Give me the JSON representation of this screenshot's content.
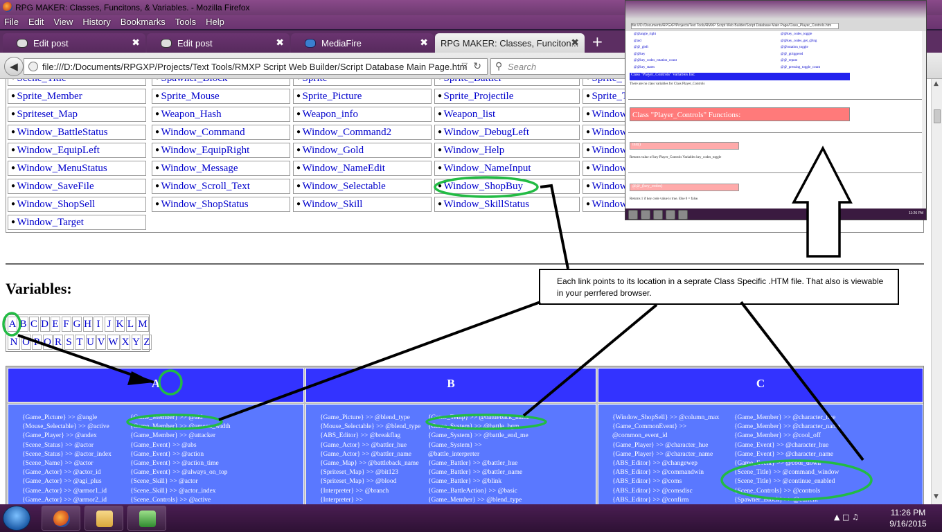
{
  "window": {
    "title": "RPG MAKER: Classes, Funcitons, & Variables. - Mozilla Firefox"
  },
  "menu": [
    "File",
    "Edit",
    "View",
    "History",
    "Bookmarks",
    "Tools",
    "Help"
  ],
  "tabs": [
    {
      "label": "Edit post",
      "close": "✖"
    },
    {
      "label": "Edit post",
      "close": "✖"
    },
    {
      "label": "MediaFire",
      "close": "✖"
    },
    {
      "label": "RPG MAKER: Classes, Funciton...",
      "close": "✖"
    }
  ],
  "new_tab": "+",
  "url": "file:///D:/Documents/RPGXP/Projects/Text Tools/RMXP Script Web Builder/Script Database Main Page.htm",
  "search_placeholder": "Search",
  "class_rows": [
    [
      "Scene_Title",
      "Spawner_Block",
      "Sprite",
      "Sprite_Battler",
      "Sprite_"
    ],
    [
      "Sprite_Member",
      "Sprite_Mouse",
      "Sprite_Picture",
      "Sprite_Projectile",
      "Sprite_T"
    ],
    [
      "Spriteset_Map",
      "Weapon_Hash",
      "Weapon_info",
      "Weapon_list",
      "Window"
    ],
    [
      "Window_BattleStatus",
      "Window_Command",
      "Window_Command2",
      "Window_DebugLeft",
      "Window"
    ],
    [
      "Window_EquipLeft",
      "Window_EquipRight",
      "Window_Gold",
      "Window_Help",
      "Window"
    ],
    [
      "Window_MenuStatus",
      "Window_Message",
      "Window_NameEdit",
      "Window_NameInput",
      "Window"
    ],
    [
      "Window_SaveFile",
      "Window_Scroll_Text",
      "Window_Selectable",
      "Window_ShopBuy",
      "Window"
    ],
    [
      "Window_ShopSell",
      "Window_ShopStatus",
      "Window_Skill",
      "Window_SkillStatus",
      "Window"
    ],
    [
      "Window_Target"
    ]
  ],
  "variables_heading": "Variables:",
  "letters_row1": [
    "A",
    "B",
    "C",
    "D",
    "E",
    "F",
    "G",
    "H",
    "I",
    "J",
    "K",
    "L",
    "M"
  ],
  "letters_row2": [
    "N",
    "O",
    "P",
    "Q",
    "R",
    "S",
    "T",
    "U",
    "V",
    "W",
    "X",
    "Y",
    "Z"
  ],
  "var_sections": [
    {
      "head": "A",
      "col1": [
        "{Game_Picture} >> @angle",
        "{Mouse_Selectable} >> @active",
        "{Game_Player} >> @andex",
        "{Scene_Status} >> @actor",
        "{Scene_Status} >> @actor_index",
        "{Scene_Name} >> @actor",
        "{Game_Actor} >> @actor_id",
        "{Game_Actor} >> @agi_plus",
        "{Game_Actor} >> @armor1_id",
        "{Game_Actor} >> @armor2_id"
      ],
      "col2": [
        "{Game_Member} >> @aid",
        "{Game_Member} >> @amenu_width",
        "{Game_Member} >> @attacker",
        "{Game_Event} >> @abs",
        "{Game_Event} >> @action",
        "{Game_Event} >> @action_time",
        "{Game_Event} >> @always_on_top",
        "{Scene_Skill} >> @actor",
        "{Scene_Skill} >> @actor_index",
        "{Scene_Controls} >> @active"
      ]
    },
    {
      "head": "B",
      "col1": [
        "{Game_Picture} >> @blend_type",
        "{Mouse_Selectable} >> @blend_type",
        "{ABS_Editor} >> @breakflag",
        "{Game_Actor} >> @battler_hue",
        "{Game_Actor} >> @battler_name",
        "{Game_Map} >> @battleback_name",
        "{Spriteset_Map} >> @bit123",
        "{Spriteset_Map} >> @blood",
        "{Interpreter} >> @branch",
        "{Interpreter} >>"
      ],
      "col2": [
        "{Game_Temp} >> @battleback_name",
        "{Game_System} >> @battle_bgm",
        "{Game_System} >> @battle_end_me",
        "{Game_System} >>",
        "@battle_interpreter",
        "{Game_Battler} >> @battler_hue",
        "{Game_Battler} >> @battler_name",
        "{Game_Battler} >> @blink",
        "{Game_BattleAction} >> @basic",
        "{Game_Member} >> @blend_type"
      ]
    },
    {
      "head": "C",
      "col1": [
        "{Window_ShopSell} >> @column_max",
        "{Game_CommonEvent} >>",
        "@common_event_id",
        "{Game_Player} >> @character_hue",
        "{Game_Player} >> @character_name",
        "{ABS_Editor} >> @changewep",
        "{ABS_Editor} >> @commandwin",
        "{ABS_Editor} >> @coms",
        "{ABS_Editor} >> @comsdisc",
        "{ABS_Editor} >> @confirm"
      ],
      "col2": [
        "{Game_Member} >> @character_hue",
        "{Game_Member} >> @character_name",
        "{Game_Member} >> @cool_off",
        "{Game_Event} >> @character_hue",
        "{Game_Event} >> @character_name",
        "{Game_Event} >> @cool_down",
        "{Scene_Title} >> @command_window",
        "{Scene_Title} >> @continue_enabled",
        "{Scene_Controls} >> @controls",
        "{Spawner_Block} >> @current"
      ]
    }
  ],
  "callout_text": "Each link points to its location in a seprate Class Specific .HTM file. That also is viewable in your perrfered browser.",
  "inset": {
    "url": "file:///D:/Documents/RPGXP/Projects/Text Tools/RMXP Script Web Builder/Script Database Main Page/Class_Player_Controls.htm",
    "links_left": [
      "@@angle_right",
      "@aid",
      "@@_gleft",
      "@@key",
      "@@key_codes_rotation_count",
      "@@key_states"
    ],
    "links_right": [
      "@@key_codes_toggle",
      "@@key_codes_get_@ing",
      "@@rotation_toggle",
      "@@_gtriggered",
      "@@_repeat",
      "@@_pressing_toggle_count"
    ],
    "variables_bar": "Class \"Player_Controls\" Variables list:",
    "no_variables": "There are no class variables for Class Player_Controls",
    "functions_bar": "Class \"Player_Controls\" Functions:",
    "func1": "init()",
    "func1_desc": "Returns value of key Player_Controls Variables key_codes_toggle",
    "func2": "@@_(key_codes)",
    "func2_desc": "Returns 1 if key code value is true. Else 0 = false.",
    "clock": "11:26 PM"
  },
  "taskbar": {
    "time": "11:26 PM",
    "date": "9/16/2015"
  },
  "colors": {
    "link": "#0000cc",
    "var_head": "#3333ff",
    "var_body": "#5a78ff",
    "highlight": "#22bb44"
  }
}
